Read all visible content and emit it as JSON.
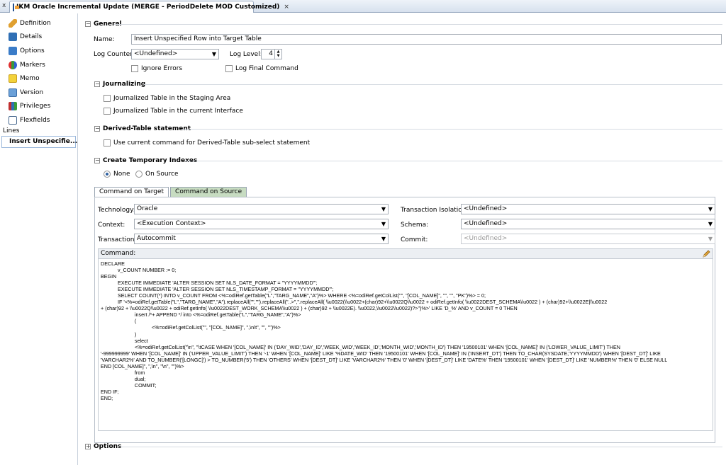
{
  "editor_tab": {
    "title": "IKM Oracle Incremental Update (MERGE - PeriodDelete MOD Customized)",
    "close": "×",
    "left_close": "x"
  },
  "sidebar": {
    "items": [
      {
        "label": "Definition",
        "icon": "pencil-icon"
      },
      {
        "label": "Details",
        "icon": "details-icon"
      },
      {
        "label": "Options",
        "icon": "options-icon"
      },
      {
        "label": "Markers",
        "icon": "markers-icon"
      },
      {
        "label": "Memo",
        "icon": "memo-icon"
      },
      {
        "label": "Version",
        "icon": "version-icon"
      },
      {
        "label": "Privileges",
        "icon": "privileges-icon"
      },
      {
        "label": "Flexfields",
        "icon": "flexfields-icon"
      }
    ],
    "section_label": "Lines",
    "selected_line": "Insert Unspecifie..."
  },
  "general": {
    "title": "General",
    "name_label": "Name:",
    "name_value": "Insert Unspecified Row into Target Table",
    "log_counter_label": "Log Counter:",
    "log_counter_value": "<Undefined>",
    "log_level_label": "Log Level:",
    "log_level_value": "4",
    "ignore_errors": "Ignore Errors",
    "log_final_command": "Log Final Command"
  },
  "journalizing": {
    "title": "Journalizing",
    "opt1": "Journalized Table in the Staging Area",
    "opt2": "Journalized Table in the current Interface"
  },
  "derived": {
    "title": "Derived-Table statement",
    "opt1": "Use current command for Derived-Table sub-select statement"
  },
  "temp_indexes": {
    "title": "Create Temporary Indexes",
    "none": "None",
    "on_source": "On Source"
  },
  "command_tabs": {
    "target": "Command on Target",
    "source": "Command on Source"
  },
  "command": {
    "technology_label": "Technology:",
    "technology_value": "Oracle",
    "context_label": "Context:",
    "context_value": "<Execution Context>",
    "transaction_label": "Transaction:",
    "transaction_value": "Autocommit",
    "isolation_label": "Transaction Isolation:",
    "isolation_value": "<Undefined>",
    "schema_label": "Schema:",
    "schema_value": "<Undefined>",
    "commit_label": "Commit:",
    "commit_value": "<Undefined>",
    "command_label": "Command:",
    "command_text": "DECLARE\n            v_COUNT NUMBER := 0;\nBEGIN\n            EXECUTE IMMEDIATE 'ALTER SESSION SET NLS_DATE_FORMAT = \"YYYYMMDD\"';\n            EXECUTE IMMEDIATE 'ALTER SESSION SET NLS_TIMESTAMP_FORMAT = \"YYYYMMDD\"';\n            SELECT COUNT(*) INTO v_COUNT FROM <%=odiRef.getTable(\"L\",\"TARG_NAME\",\"A\")%> WHERE <%=odiRef.getColList(\"\", \"[COL_NAME]\", \"\", \"\", \"PK\")%> = 0;\n            IF '<%=odiRef.getTable(\"L\",\"TARG_NAME\",\"A\").replaceAll(\"\",\"\").replaceAll(\"..>\",\".replaceAll( \\\\u0022(\\\\u0022+(char)92+\\\\u0022Q\\\\u0022 + odiRef.getInfo( \\\\u0022DEST_SCHEMA\\\\u0022 ) + (char)92+\\\\u0022E|\\\\u0022\n+ (char)92 + \\\\u0022Q\\\\u0022 + odiRef.getInfo( \\\\u0022DEST_WORK_SCHEMA\\\\u0022 ) + (char)92 + \\\\u0022E). \\\\u0022,\\\\u0022\\\\u0022)?>\")%>' LIKE 'D_%' AND v_COUNT = 0 THEN\n                        insert /*+ APPEND */ into <%=odiRef.getTable(\"L\",\"TARG_NAME\",\"A\")%>\n                        (\n                                    <%=odiRef.getColList(\"\", \"[COL_NAME]\", \",\\n\\t\", \"\", \"\")%>\n                        )\n                        select\n                        <%=odiRef.getColList(\"\\n\", \"\\tCASE WHEN '[COL_NAME]' IN ('DAY_WID','DAY_ID','WEEK_WID','WEEK_ID','MONTH_WID','MONTH_ID') THEN '19500101' WHEN '[COL_NAME]' IN ('LOWER_VALUE_LIMIT') THEN\n'-999999999' WHEN '[COL_NAME]' IN ('UPPER_VALUE_LIMIT') THEN '-1' WHEN '[COL_NAME]' LIKE '%DATE_WID' THEN '19500101' WHEN '[COL_NAME]' IN ('INSERT_DT') THEN TO_CHAR(SYSDATE,'YYYYMMDD') WHEN '[DEST_DT]' LIKE\n'VARCHAR2%' AND TO_NUMBER('[LONGC]') > TO_NUMBER('5') THEN 'OTHERS' WHEN '[DEST_DT]' LIKE 'VARCHAR2%' THEN '0' WHEN '[DEST_DT]' LIKE 'DATE%' THEN '19500101' WHEN '[DEST_DT]' LIKE 'NUMBER%' THEN '0' ELSE NULL\nEND [COL_NAME]\", \",\\n\", \"\\n\", \"\")%>\n                        from\n                        dual;\n                        COMMIT;\nEND IF;\nEND;"
  },
  "options_section": {
    "title": "Options"
  }
}
